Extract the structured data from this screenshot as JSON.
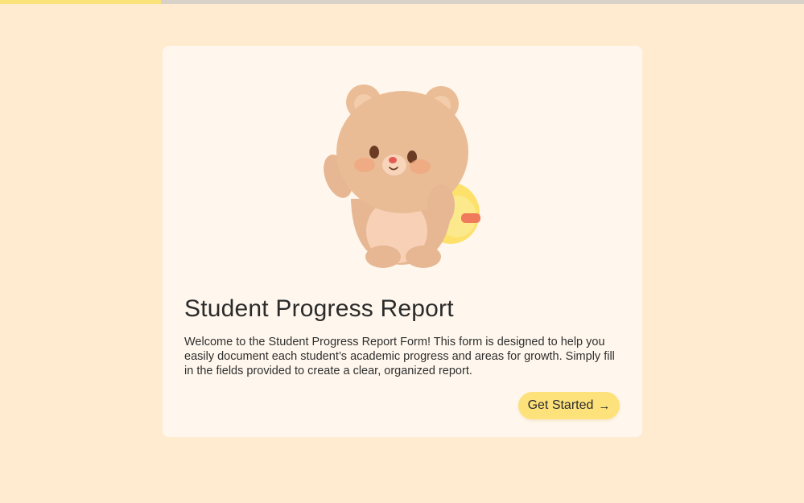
{
  "progress": {
    "fraction": 0.2,
    "track_color": "#d8d1c8",
    "fill_color": "#fbe27b"
  },
  "colors": {
    "background": "#ffebcf",
    "card": "#fff7ed",
    "accent": "#fde27c"
  },
  "welcome": {
    "mascot_icon": "bear-with-backpack-illustration",
    "title": "Student Progress Report",
    "description": "Welcome to the Student Progress Report Form! This form is designed to help you easily document each student’s academic progress and areas for growth. Simply fill in the fields provided to create a clear, organized report.",
    "button_label": "Get Started",
    "button_icon": "arrow-right-icon",
    "button_arrow": "→"
  }
}
